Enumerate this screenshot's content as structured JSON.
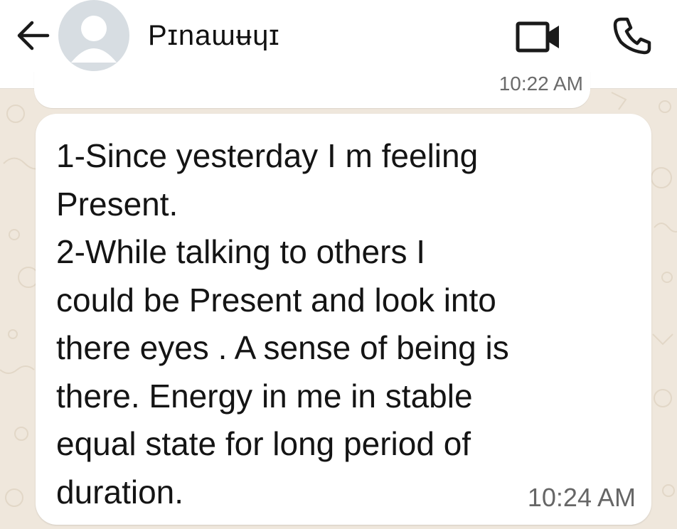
{
  "header": {
    "back_icon": "arrow-left-icon",
    "avatar_icon": "default-person-icon",
    "contact_name": "Pɪnaɯʉɥɪ",
    "video_icon": "video-camera-icon",
    "call_icon": "phone-icon"
  },
  "previous_message": {
    "time": "10:22 AM"
  },
  "message": {
    "text": "1-Since yesterday I m feeling\nPresent.\n2-While talking to others I\ncould be Present and look into\nthere eyes . A sense of being is\nthere. Energy  in me in stable\nequal state for long period of\nduration.",
    "time": "10:24 AM"
  },
  "colors": {
    "header_bg": "#ffffff",
    "chat_bg": "#efe7dc",
    "bubble_bg": "#ffffff",
    "text": "#141414",
    "timestamp": "#666666"
  }
}
